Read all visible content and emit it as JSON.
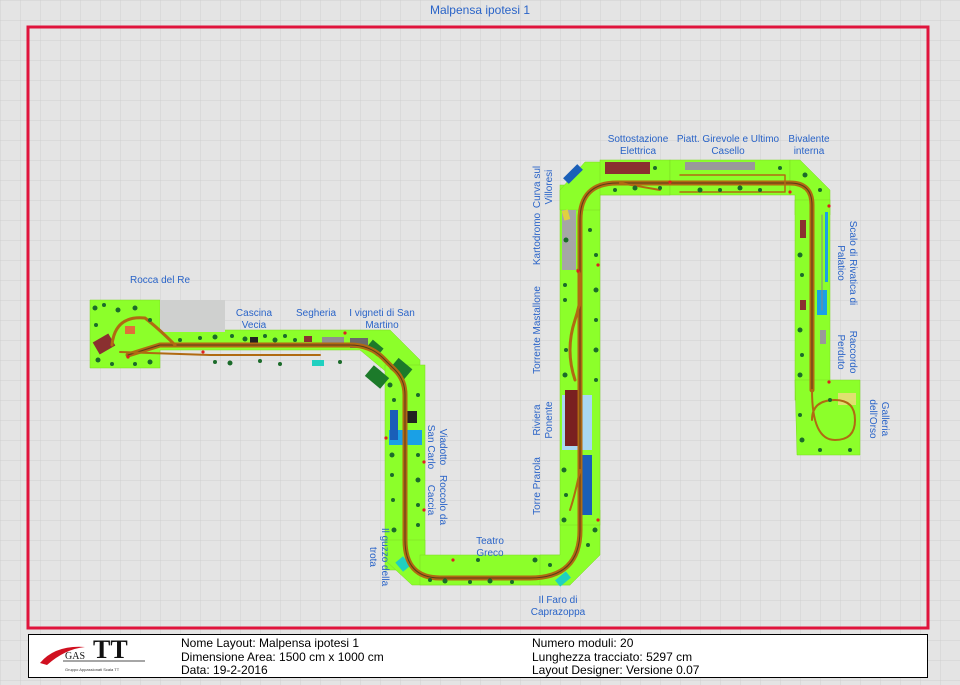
{
  "layout_title": "Malpensa ipotesi 1",
  "colors": {
    "border": "#e0143c",
    "board": "#8cff2a",
    "track_bed": "#b06a12",
    "rail": "#5a3a1a",
    "label": "#2a64c8",
    "water": "#1aa0e6",
    "grid": "#cfcfcf"
  },
  "labels": {
    "rocca": "Rocca del Re",
    "cascina": "Cascina\nVecia",
    "segheria": "Segheria",
    "vigneti": "I vigneti di San\nMartino",
    "viadotto": "Viadotto\nSan Carlo",
    "roccolo": "Roccolo da\nCaccia",
    "guzzo": "Il guzzo della\ntrota",
    "teatro": "Teatro\nGreco",
    "faro": "Il Faro di\nCaprazoppa",
    "torre": "Torre Prarola",
    "riviera": "Riviera\nPonente",
    "torrente": "Torrente Mastallone",
    "kartodromo": "Kartodromo",
    "curva": "Curva sul\nVilloresi",
    "sottostazione": "Sottostazione\nElettrica",
    "piatt": "Piatt. Girevole e Ultimo\nCasello",
    "bivalente": "Bivalente\ninterna",
    "scalo": "Scalo di Rivatica di\nPalatico",
    "raccordo": "Raccordo\nPerduto",
    "galleria": "Galleria\ndell'Orso"
  },
  "info": {
    "logo_text": "TT",
    "logo_gas": "GAS",
    "logo_sub": "Gruppo Appassionati Scala TT",
    "nome_layout": "Nome Layout: Malpensa ipotesi 1",
    "dimensione": "Dimensione Area: 1500 cm x 1000 cm",
    "data": "Data: 19-2-2016",
    "numero_moduli": "Numero moduli: 20",
    "lunghezza": "Lunghezza tracciato: 5297 cm",
    "designer": "Layout Designer: Versione 0.07"
  }
}
